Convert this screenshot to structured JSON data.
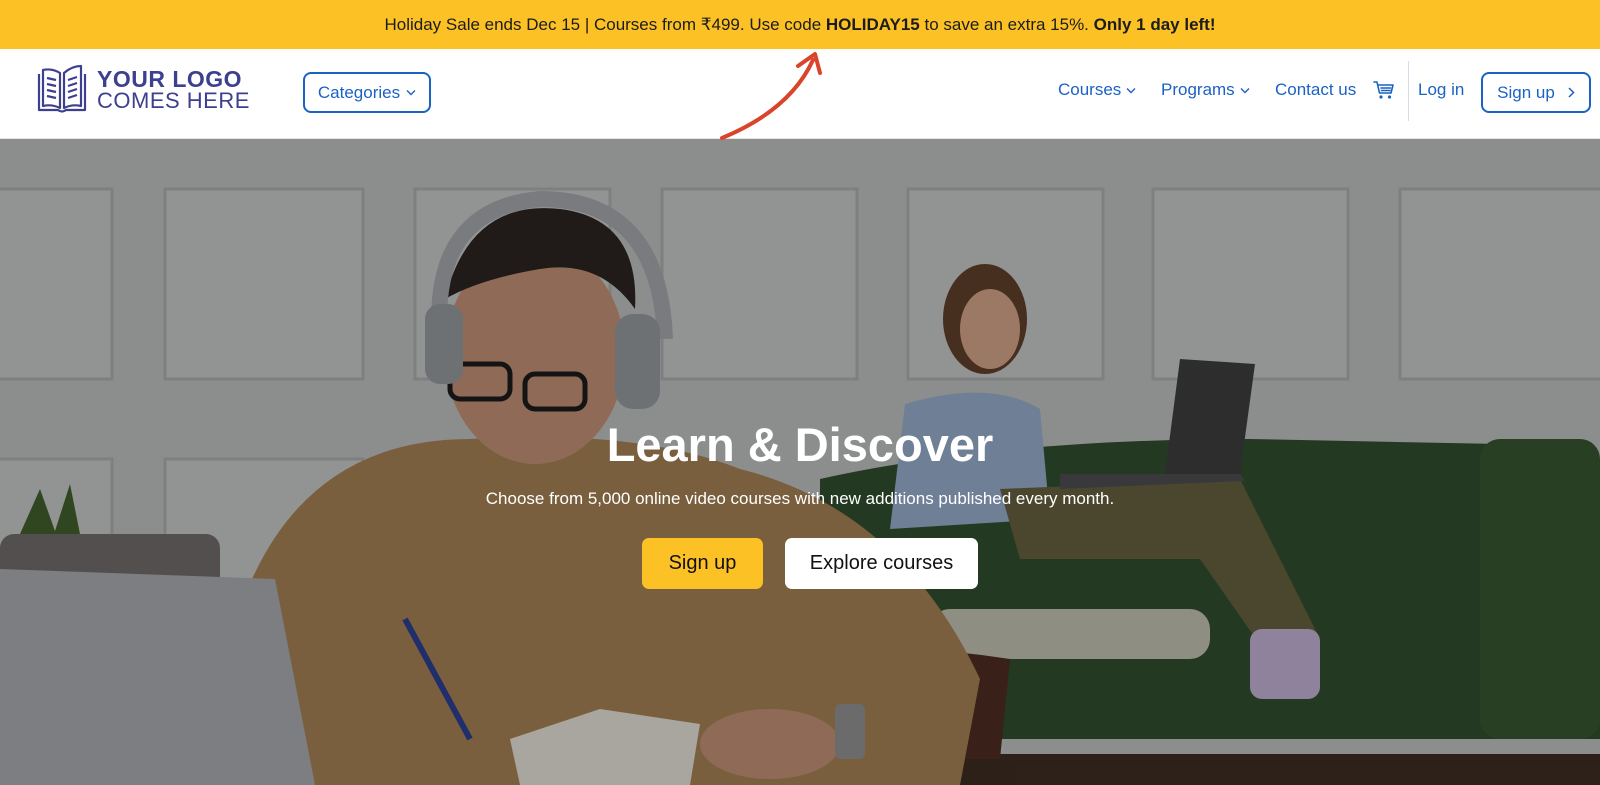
{
  "promo": {
    "text_prefix": "Holiday Sale ends Dec 15 | Courses from ₹499. Use code ",
    "code": "HOLIDAY15",
    "text_mid": " to save an extra 15%. ",
    "urgency": "Only 1 day left!",
    "background_color": "#fcc125"
  },
  "header": {
    "logo": {
      "line1": "YOUR LOGO",
      "line2": "COMES HERE",
      "icon": "open-book-icon"
    },
    "categories_label": "Categories",
    "nav": {
      "courses": "Courses",
      "programs": "Programs",
      "contact": "Contact us",
      "cart_icon": "cart-icon",
      "login": "Log in",
      "signup": "Sign up"
    },
    "accent_color": "#1b62c4"
  },
  "hero": {
    "title": "Learn & Discover",
    "subtitle": "Choose from 5,000 online video courses with new additions published every month.",
    "signup_label": "Sign up",
    "explore_label": "Explore courses",
    "signup_color": "#fcc125"
  }
}
